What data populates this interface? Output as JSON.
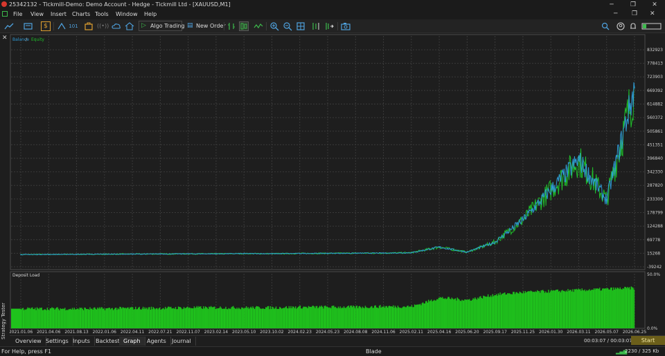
{
  "window": {
    "title": "25342132 - Tickmill-Demo: Demo Account - Hedge - Tickmill Ltd - [XAUUSD,M1]",
    "minimize": "─",
    "restore": "❐",
    "close": "✕"
  },
  "menu": {
    "items": [
      "File",
      "View",
      "Insert",
      "Charts",
      "Tools",
      "Window",
      "Help"
    ],
    "doc_minimize": "─",
    "doc_restore": "❐",
    "doc_close": "✕"
  },
  "toolbar": {
    "algo_trading": "Algo Trading",
    "new_order": "New Order"
  },
  "chart_data": [
    {
      "type": "line",
      "legend": [
        "Balance",
        "Equity"
      ],
      "legend_sep": " / ",
      "colors": {
        "balance": "#2e9bd6",
        "equity": "#1fbf2a",
        "grid": "#3a3a3a",
        "axis_text": "#cfcfcf"
      },
      "y_ticks": [
        832923,
        778413,
        723903,
        669392,
        614882,
        560372,
        505861,
        451351,
        396840,
        342330,
        287820,
        233309,
        178799,
        124288,
        69778,
        15268,
        -39242
      ],
      "ylim": [
        -39242,
        832923
      ],
      "x": [
        "2021.01.06",
        "2021.04.06",
        "2021.08.13",
        "2022.01.06",
        "2022.04.11",
        "2022.07.21",
        "2022.11.07",
        "2023.02.14",
        "2023.05.10",
        "2023.10.02",
        "2024.02.23",
        "2024.05.23",
        "2024.08.08",
        "2024.11.06",
        "2025.02.11",
        "2025.04.16",
        "2025.06.20",
        "2025.09.17",
        "2025.11.25",
        "2026.01.30",
        "2026.03.11",
        "2026.05.07",
        "2026.06.25"
      ],
      "series": [
        {
          "name": "Balance",
          "values": [
            10000,
            10500,
            11000,
            11500,
            12000,
            12500,
            13000,
            13000,
            14000,
            13500,
            14500,
            15000,
            15500,
            16000,
            17500,
            40000,
            20000,
            60000,
            150000,
            270000,
            390000,
            230000,
            680000
          ]
        },
        {
          "name": "Equity",
          "values": [
            10000,
            10500,
            11000,
            11500,
            12000,
            12500,
            13000,
            13000,
            14000,
            13500,
            14500,
            15000,
            15500,
            16000,
            17500,
            40000,
            20000,
            60000,
            150000,
            270000,
            390000,
            230000,
            680000
          ]
        }
      ]
    },
    {
      "type": "bar",
      "legend": "Deposit Load",
      "color": "#1fc21c",
      "y_ticks": [
        "50.0%",
        "0.0%"
      ],
      "ylim": [
        0,
        50
      ],
      "x": [
        "2021.01.06",
        "2021.04.06",
        "2021.08.13",
        "2022.01.06",
        "2022.04.11",
        "2022.07.21",
        "2022.11.07",
        "2023.02.14",
        "2023.05.10",
        "2023.10.02",
        "2024.02.23",
        "2024.05.23",
        "2024.08.08",
        "2024.11.06",
        "2025.02.11",
        "2025.04.16",
        "2025.06.20",
        "2025.09.17",
        "2025.11.25",
        "2026.01.30",
        "2026.03.11",
        "2026.05.07",
        "2026.06.25"
      ],
      "values": [
        18,
        18,
        18,
        18,
        18.5,
        18.5,
        19,
        19,
        19,
        19,
        19.5,
        19.5,
        19.5,
        20,
        20,
        28,
        26,
        31,
        33,
        34,
        35,
        36,
        37
      ]
    }
  ],
  "side": {
    "close": "✕",
    "label": "Strategy Tester"
  },
  "tabs": [
    "Overview",
    "Settings",
    "Inputs",
    "Backtest",
    "Graph",
    "Agents",
    "Journal"
  ],
  "active_tab": "Graph",
  "timer": "00:03:07 / 00:03:07",
  "start_button": "Start",
  "status": {
    "help": "For Help, press F1",
    "profile": "Blade",
    "traffic": "2230 / 325 Kb"
  }
}
